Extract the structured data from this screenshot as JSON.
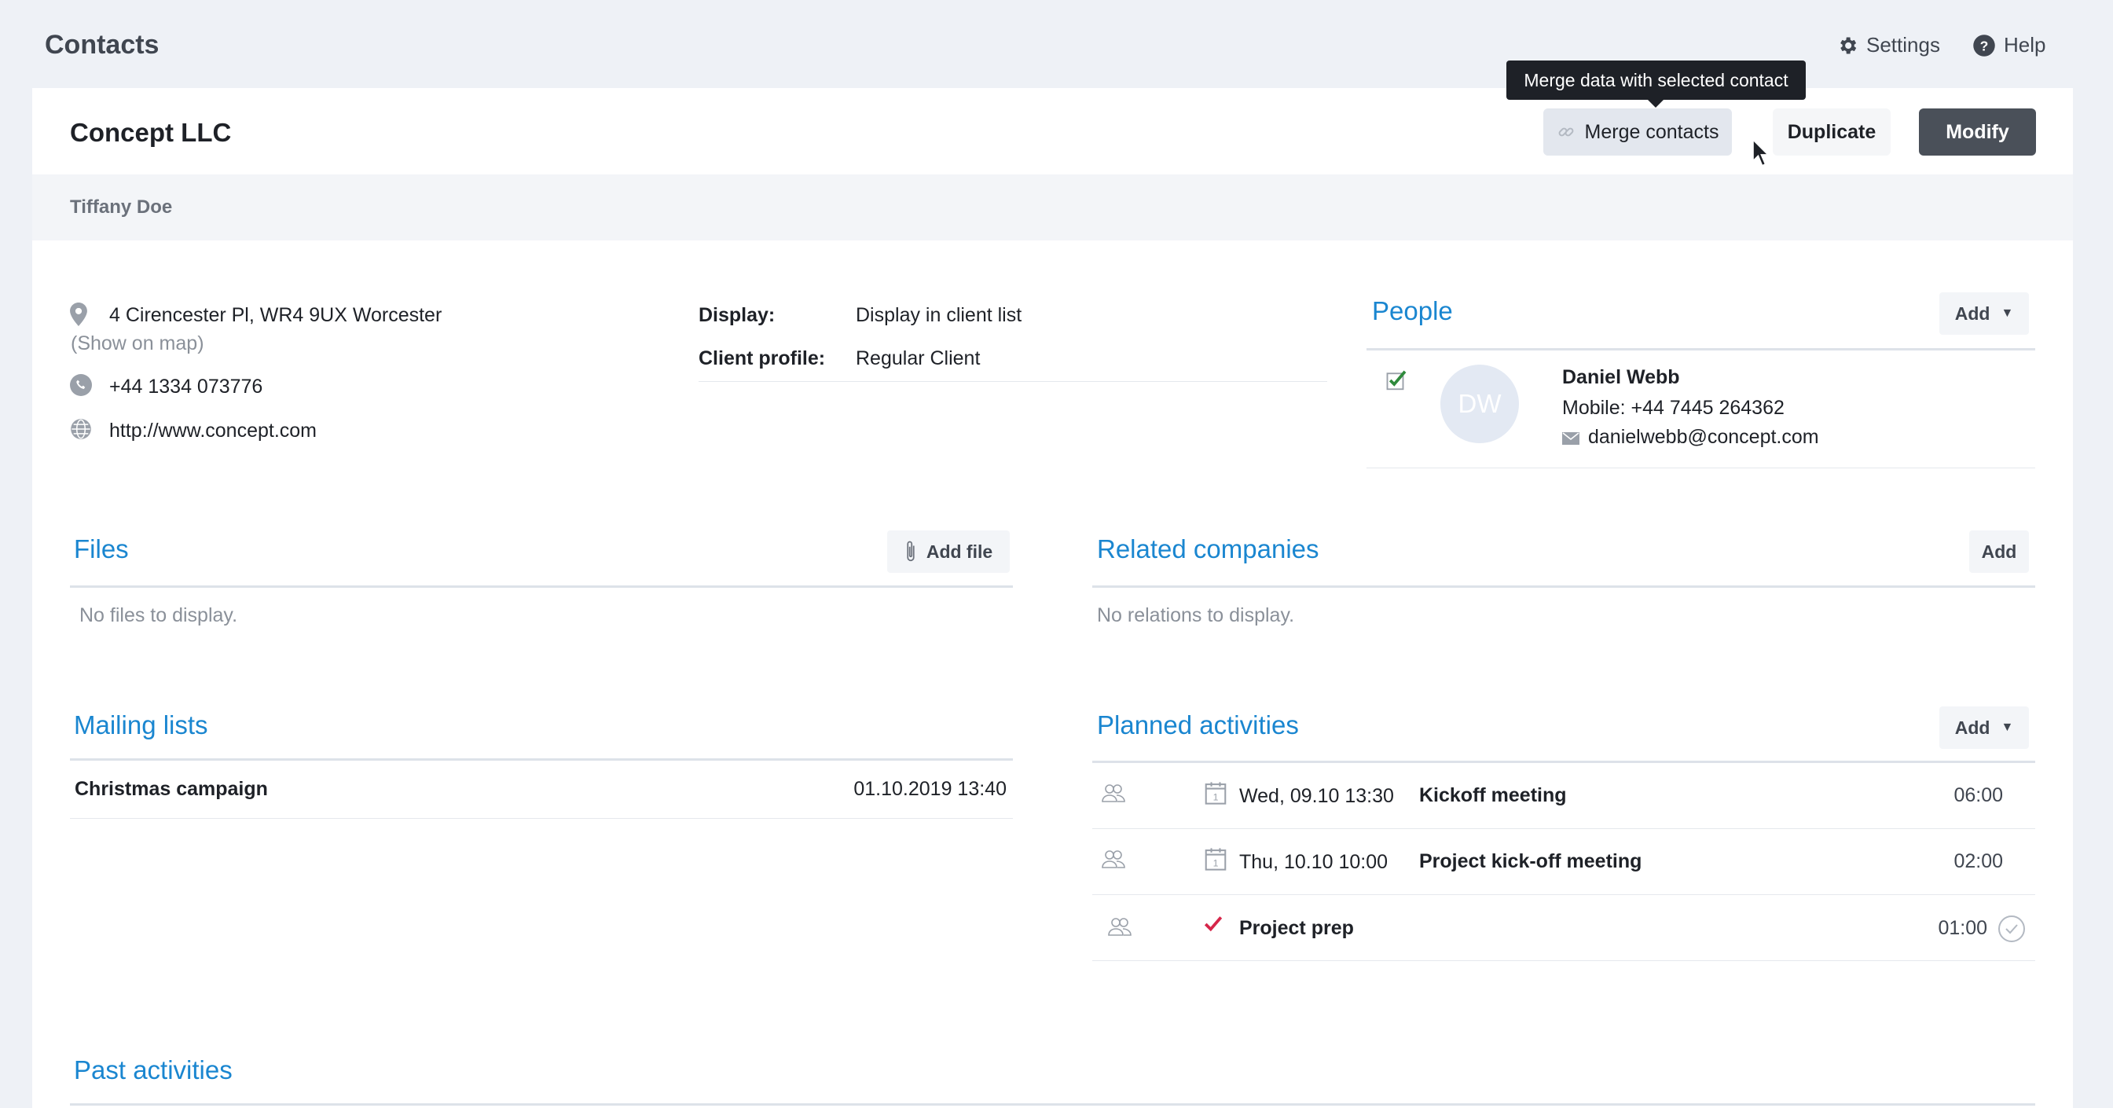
{
  "app": {
    "title": "Contacts"
  },
  "topnav": {
    "settings_label": "Settings",
    "help_label": "Help"
  },
  "header": {
    "company_name": "Concept LLC",
    "merge_label": "Merge contacts",
    "duplicate_label": "Duplicate",
    "modify_label": "Modify",
    "tooltip": "Merge data with selected contact"
  },
  "contact": {
    "person": "Tiffany Doe",
    "address": "4 Cirencester Pl, WR4 9UX Worcester",
    "show_map": "(Show on map)",
    "phone": "+44 1334 073776",
    "website": "http://www.concept.com",
    "display_label": "Display:",
    "display_value": "Display in client list",
    "profile_label": "Client profile:",
    "profile_value": "Regular Client"
  },
  "people": {
    "title": "People",
    "add_label": "Add",
    "items": [
      {
        "initials": "DW",
        "name": "Daniel Webb",
        "mobile": "Mobile: +44 7445 264362",
        "email": "danielwebb@concept.com"
      }
    ]
  },
  "files": {
    "title": "Files",
    "add_label": "Add file",
    "empty": "No files to display."
  },
  "related": {
    "title": "Related companies",
    "add_label": "Add",
    "empty": "No relations to display."
  },
  "mailing": {
    "title": "Mailing lists",
    "items": [
      {
        "name": "Christmas campaign",
        "date": "01.10.2019 13:40"
      }
    ]
  },
  "planned": {
    "title": "Planned activities",
    "add_label": "Add",
    "items": [
      {
        "date": "Wed, 09.10 13:30",
        "name": "Kickoff meeting",
        "duration": "06:00"
      },
      {
        "date": "Thu, 10.10 10:00",
        "name": "Project kick-off meeting",
        "duration": "02:00"
      },
      {
        "date": "",
        "name": "Project prep",
        "duration": "01:00"
      }
    ]
  },
  "past": {
    "title": "Past activities"
  },
  "colors": {
    "accent": "#1a86d0",
    "dark_button": "#4a5059",
    "check_red": "#d6264a",
    "check_green": "#2f8a3c"
  }
}
